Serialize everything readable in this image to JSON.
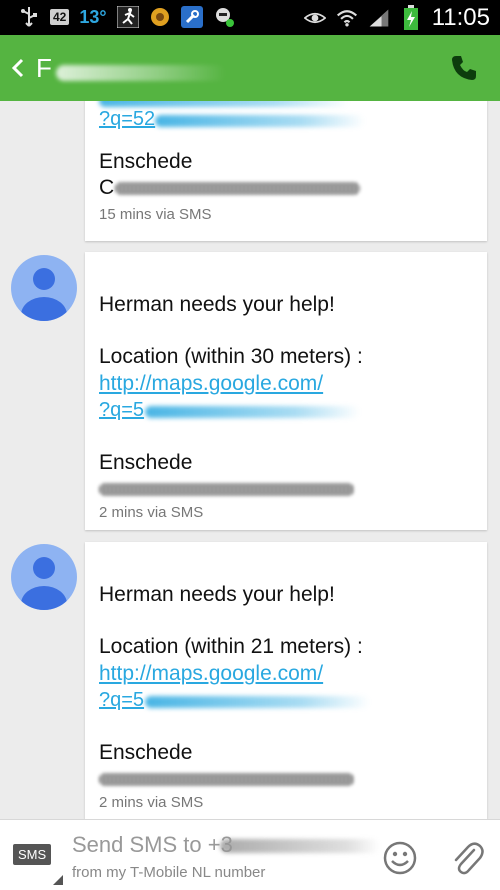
{
  "status_bar": {
    "badge": "42",
    "temperature": "13°",
    "time": "11:05"
  },
  "header": {
    "contact_initial": "F"
  },
  "messages": [
    {
      "link_prefix": "?q=52",
      "city": "Enschede",
      "address_prefix": "C",
      "meta": "15 mins via SMS"
    },
    {
      "title": "Herman needs your help!",
      "location": "Location (within 30 meters) :",
      "link": "http://maps.google.com/",
      "link_prefix": "?q=5",
      "city": "Enschede",
      "meta": "2 mins via SMS"
    },
    {
      "title": "Herman needs your help!",
      "location": "Location (within 21 meters) :",
      "link": "http://maps.google.com/",
      "link_prefix": "?q=5",
      "city": "Enschede",
      "meta": "2 mins via SMS"
    }
  ],
  "compose": {
    "badge": "SMS",
    "placeholder": "Send SMS to +3",
    "subtitle": "from my T-Mobile  NL number"
  },
  "colors": {
    "accent": "#55b441",
    "link": "#29a8e0",
    "avatar_bg": "#8eb3f2",
    "avatar_fg": "#3b6fe0"
  }
}
